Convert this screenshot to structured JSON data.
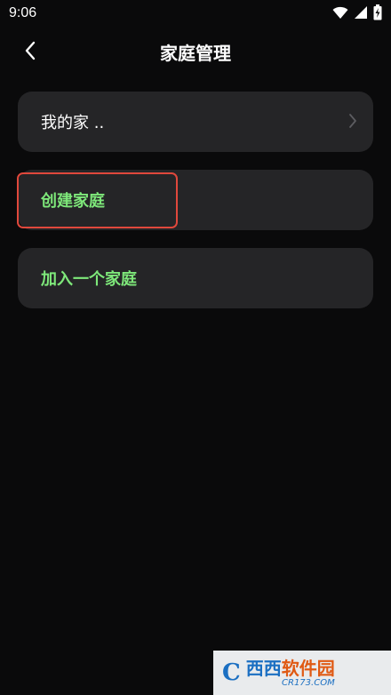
{
  "status_bar": {
    "time": "9:06",
    "icons": [
      "wifi-icon",
      "signal-icon",
      "battery-charging-icon"
    ]
  },
  "header": {
    "title": "家庭管理",
    "back_icon": "chevron-left-icon"
  },
  "cards": {
    "home": {
      "label": "我的家 ..",
      "icon": "chevron-right-icon"
    },
    "create": {
      "label": "创建家庭"
    },
    "join": {
      "label": "加入一个家庭"
    }
  },
  "watermark": {
    "logo": "C",
    "brand_a": "西西",
    "brand_b": "软件园",
    "domain": "CR173.COM"
  },
  "colors": {
    "background": "#0a0a0b",
    "card": "#252527",
    "accent_green": "#7ee87a",
    "highlight_red": "#e0483c"
  }
}
